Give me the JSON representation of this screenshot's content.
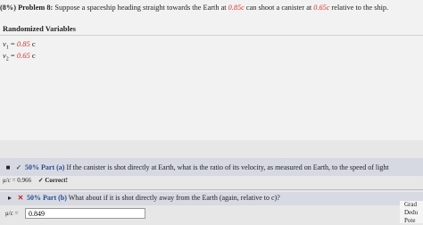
{
  "problem": {
    "prefix": "(8%)",
    "label": "Problem 8:",
    "text1": "Suppose a spaceship heading straight towards the Earth at",
    "v1": "0.85c",
    "text2": "can shoot a canister at",
    "v2": "0.65c",
    "text3": "relative to the ship."
  },
  "randomized": {
    "title": "Randomized Variables",
    "vars": [
      {
        "name": "v",
        "sub": "1",
        "eq": "=",
        "value": "0.85",
        "unit": "c"
      },
      {
        "name": "v",
        "sub": "2",
        "eq": "=",
        "value": "0.65",
        "unit": "c"
      }
    ]
  },
  "partA": {
    "percent": "50%",
    "label": "Part (a)",
    "question": "If the canister is shot directly at Earth, what is the ratio of its velocity, as measured on Earth, to the speed of light",
    "answer_prefix": "μ/c = 0.966",
    "status": "✓ Correct!"
  },
  "partB": {
    "percent": "50%",
    "label": "Part (b)",
    "question": "What about if it is shot directly away from the Earth (again, relative to c)?",
    "answer_prefix": "μ/c =",
    "answer_value": "0.849"
  },
  "grade": {
    "line1": "Grad",
    "line2": "Dedu",
    "line3": "Pote"
  },
  "colors": {
    "accent_red": "#e0332e",
    "part_label_blue": "#2b4c8a"
  }
}
